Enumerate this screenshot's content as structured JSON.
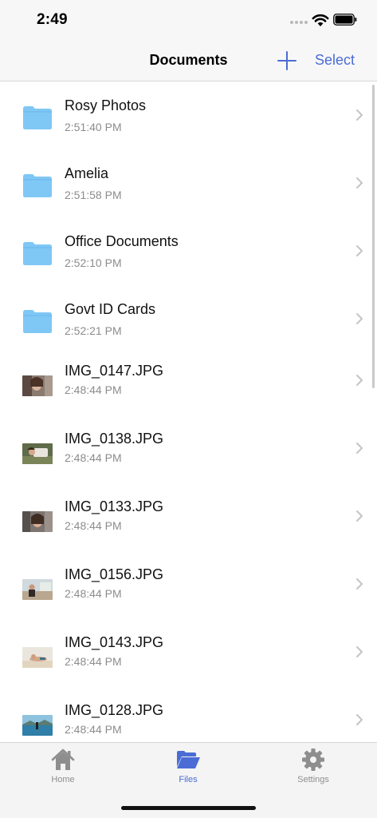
{
  "status_bar": {
    "time": "2:49"
  },
  "nav": {
    "title": "Documents",
    "select_label": "Select",
    "add_icon": "plus-icon"
  },
  "files": [
    {
      "name": "Rosy Photos",
      "time": "2:51:40 PM",
      "kind": "folder"
    },
    {
      "name": "Amelia",
      "time": "2:51:58 PM",
      "kind": "folder"
    },
    {
      "name": "Office Documents",
      "time": "2:52:10 PM",
      "kind": "folder"
    },
    {
      "name": "Govt ID Cards",
      "time": "2:52:21 PM",
      "kind": "folder"
    },
    {
      "name": "IMG_0147.JPG",
      "time": "2:48:44 PM",
      "kind": "image"
    },
    {
      "name": "IMG_0138.JPG",
      "time": "2:48:44 PM",
      "kind": "image"
    },
    {
      "name": "IMG_0133.JPG",
      "time": "2:48:44 PM",
      "kind": "image"
    },
    {
      "name": "IMG_0156.JPG",
      "time": "2:48:44 PM",
      "kind": "image"
    },
    {
      "name": "IMG_0143.JPG",
      "time": "2:48:44 PM",
      "kind": "image"
    },
    {
      "name": "IMG_0128.JPG",
      "time": "2:48:44 PM",
      "kind": "image"
    }
  ],
  "tabs": [
    {
      "label": "Home",
      "icon": "home-icon",
      "active": false
    },
    {
      "label": "Files",
      "icon": "folder-open-icon",
      "active": true
    },
    {
      "label": "Settings",
      "icon": "gear-icon",
      "active": false
    }
  ],
  "colors": {
    "accent": "#4a6cd4",
    "folder": "#7fc7f5",
    "secondary_text": "#8c8c8c"
  }
}
